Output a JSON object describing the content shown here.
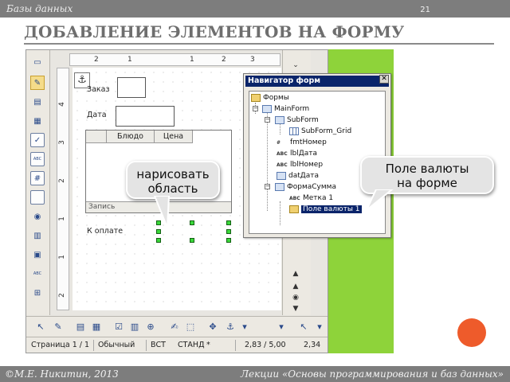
{
  "slide": {
    "header_text": "Базы данных",
    "page_number": "21",
    "title": "ДОБАВЛЕНИЕ ЭЛЕМЕНТОВ НА ФОРМУ",
    "footer_left": "©М.Е. Никитин, 2013",
    "footer_right": "Лекции «Основы программирования и баз данных»"
  },
  "ruler": {
    "top_ticks": [
      "2",
      "1",
      "1",
      "2",
      "3"
    ],
    "left_ticks": [
      "4",
      "3",
      "2",
      "1",
      "1",
      "2"
    ]
  },
  "form": {
    "label_order": "Заказ",
    "label_date": "Дата",
    "label_pay": "К оплате",
    "grid_col1": "Блюдо",
    "grid_col2": "Цена",
    "grid_status": "Запись"
  },
  "navigator": {
    "title": "Навигатор форм",
    "close": "✕",
    "nodes": {
      "root": "Формы",
      "mainform": "MainForm",
      "subform": "SubForm",
      "subform_grid": "SubForm_Grid",
      "fmt_nomer": "fmtНомер",
      "lbl_data": "lblДата",
      "lbl_nomer": "lblНомер",
      "dat_data": "datДата",
      "forma_summa": "ФормаСумма",
      "metka": "Метка 1",
      "pole_valyuty": "Поле валюты 1"
    },
    "icon_abc": "ABC",
    "icon_hash": "#"
  },
  "status": {
    "page": "Страница 1 / 1",
    "style": "Обычный",
    "ins": "ВСТ",
    "std": "СТАНД",
    "star": "*",
    "pos": "2,83 / 5,00",
    "size": "2,34"
  },
  "callouts": {
    "draw_area": "нарисовать\nобласть",
    "currency_field": "Поле валюты\nна форме"
  },
  "colors": {
    "green_panel": "#8ed33a",
    "orange_circle": "#ee5b2b",
    "title_bar": "#0a246a"
  }
}
